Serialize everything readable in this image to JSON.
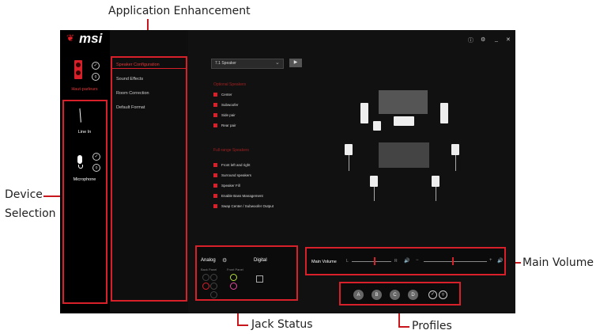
{
  "callouts": {
    "app_enh": "Application Enhancement",
    "device_sel_1": "Device",
    "device_sel_2": "Selection",
    "main_volume": "Main Volume",
    "jack_status": "Jack Status",
    "profiles": "Profiles"
  },
  "app": {
    "logo": "msi",
    "window": {
      "info": "ⓘ",
      "settings": "⚙",
      "minimize": "_",
      "close": "✕"
    },
    "devices": [
      {
        "label": "Haut-parleurs",
        "active": true
      },
      {
        "label": "Line In",
        "active": false
      },
      {
        "label": "Microphone",
        "active": false
      }
    ],
    "menu": [
      "Speaker Configuration",
      "Sound Effects",
      "Room Correction",
      "Default Format"
    ],
    "speaker_select": {
      "value": "7.1 Speaker"
    },
    "optional_heading": "Optional Speakers",
    "optional": [
      "Center",
      "Subwoofer",
      "Side pair",
      "Rear pair"
    ],
    "fullrange_heading": "Full-range Speakers",
    "fullrange": [
      "Front left and right",
      "Surround speakers",
      "Speaker Fill",
      "Enable Bass Management",
      "Swap Center / Subwoofer Output"
    ],
    "jack": {
      "analog": "Analog",
      "digital": "Digital",
      "back": "Back Panel",
      "front": "Front Panel"
    },
    "volume": {
      "label": "Main Volume",
      "left": "L",
      "right": "R",
      "minus": "−",
      "plus": "+",
      "balance": 0.55,
      "level": 0.45
    },
    "profiles": [
      "A",
      "B",
      "C",
      "D"
    ]
  }
}
